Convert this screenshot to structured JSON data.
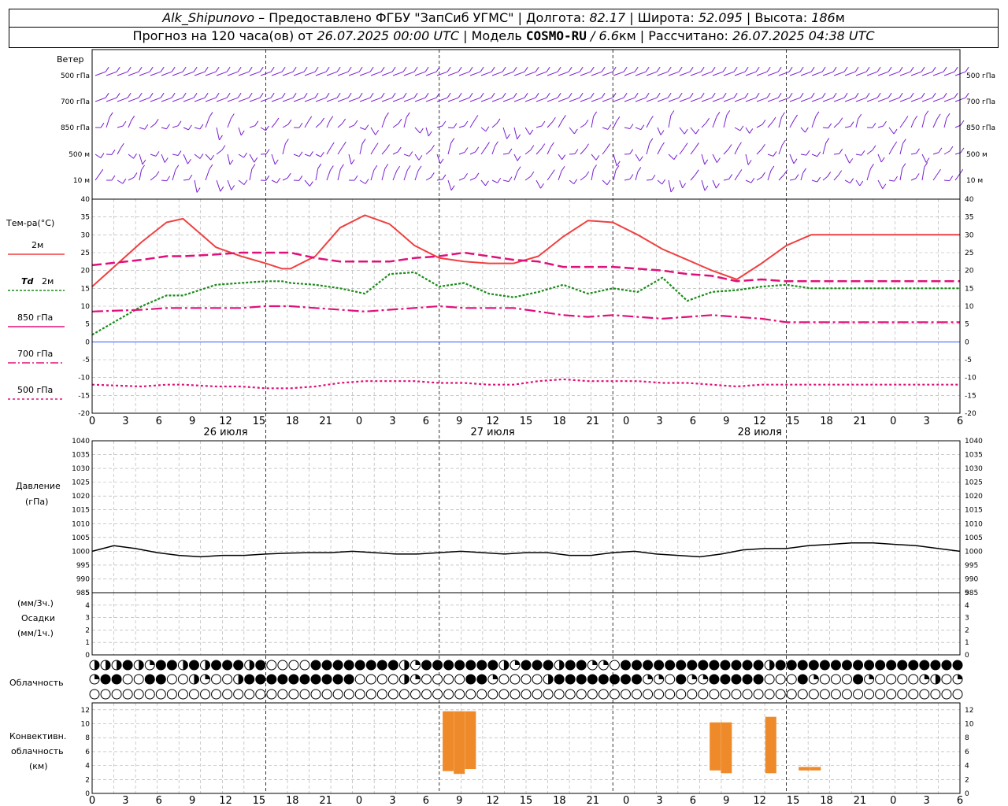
{
  "header": {
    "station": "Alk_Shipunovo",
    "provider": "– Предоставлено ФГБУ \"ЗапСиб УГМС\" | Долгота:",
    "lon": "82.17",
    "lat_label": "| Широта:",
    "lat": "52.095",
    "alt_label": "| Высота:",
    "alt": "186",
    "alt_unit": "м",
    "forecast_label": "Прогноз на 120 часа(ов) от",
    "forecast_from": "26.07.2025 00:00 UTC",
    "model_label": "| Модель",
    "model": "COSMO-RU",
    "model_res": "/ 6.6",
    "model_unit": "км | Рассчитано:",
    "calc_time": "26.07.2025 04:38 UTC"
  },
  "wind": {
    "title": "Ветер",
    "levels": [
      "500 гПа",
      "700 гПа",
      "850 гПа",
      "500 м",
      "10 м"
    ]
  },
  "temperature": {
    "title": "Тем-ра(°C)",
    "legend": {
      "t2m": "2м",
      "td": "Td",
      "td_suffix": "2м",
      "l850": "850 гПа",
      "l700": "700 гПа",
      "l500": "500 гПа"
    },
    "colors": {
      "t2m": "#f04040",
      "td": "#1a8c1a",
      "t850": "#e0107a",
      "t700": "#e0107a",
      "t500": "#e0107a"
    },
    "yticks": [
      "40",
      "35",
      "30",
      "25",
      "20",
      "15",
      "10",
      "5",
      "0",
      "-5",
      "-10",
      "-15",
      "-20"
    ]
  },
  "xaxis": {
    "hours": [
      "0",
      "3",
      "6",
      "9",
      "12",
      "15",
      "18",
      "21",
      "0",
      "3",
      "6",
      "9",
      "12",
      "15",
      "18",
      "21",
      "0",
      "3",
      "6",
      "9",
      "12",
      "15",
      "18",
      "21",
      "0",
      "3",
      "6"
    ],
    "days": [
      "26 июля",
      "27 июля",
      "28 июля"
    ]
  },
  "pressure": {
    "title1": "Давление",
    "title2": "(гПа)",
    "yticks": [
      "1040",
      "1035",
      "1030",
      "1025",
      "1020",
      "1015",
      "1010",
      "1005",
      "1000",
      "995",
      "990",
      "985"
    ]
  },
  "precip": {
    "title1": "(мм/3ч.)",
    "title2": "Осадки",
    "title3": "(мм/1ч.)",
    "yticks": [
      "5",
      "4",
      "3",
      "2",
      "1",
      "0"
    ]
  },
  "clouds": {
    "title": "Облачность"
  },
  "convective": {
    "title1": "Конвективн.",
    "title2": "облачность",
    "title3": "(км)",
    "yticks": [
      "12",
      "10",
      "8",
      "6",
      "4",
      "2",
      "0"
    ],
    "color": "#ee8a2a"
  },
  "chart_data": [
    {
      "type": "line",
      "title": "Тем-ра(°C)",
      "x_hours": [
        0,
        6,
        9,
        11,
        15,
        18,
        21,
        23,
        24,
        27,
        30,
        33,
        36,
        39,
        42,
        45,
        48,
        51,
        54,
        57,
        60,
        63,
        66,
        69,
        72,
        75,
        78,
        81,
        84,
        87,
        90,
        93,
        96,
        99,
        102,
        105
      ],
      "ylim": [
        -20,
        40
      ],
      "series": [
        {
          "name": "2м",
          "values": [
            15.5,
            28,
            33.5,
            34.5,
            26.5,
            24,
            22,
            20.5,
            20.5,
            24,
            32,
            35.5,
            33,
            27,
            23.5,
            22.5,
            22,
            22,
            24,
            29.5,
            34,
            33.5,
            30,
            26,
            23,
            20,
            17.5,
            22,
            27,
            30,
            30,
            30,
            30,
            30,
            30,
            30
          ]
        },
        {
          "name": "Td 2м",
          "values": [
            2,
            10,
            13,
            13,
            16,
            16.5,
            17,
            17,
            16.5,
            16,
            15,
            13.5,
            19,
            19.5,
            15.5,
            16.5,
            13.5,
            12.5,
            14,
            16,
            13.5,
            15,
            14,
            18,
            11.5,
            14,
            14.5,
            15.5,
            16,
            15,
            15,
            15,
            15,
            15,
            15,
            15
          ]
        },
        {
          "name": "850 гПа",
          "values": [
            8.5,
            9,
            9.5,
            9.5,
            9.5,
            9.5,
            10,
            10,
            10,
            9.5,
            9,
            8.5,
            9,
            9.5,
            10,
            9.5,
            9.5,
            9.5,
            8.5,
            7.5,
            7,
            7.5,
            7,
            6.5,
            7,
            7.5,
            7,
            6.5,
            5.5,
            5.5,
            5.5,
            5.5,
            5.5,
            5.5,
            5.5,
            5.5
          ]
        },
        {
          "name": "700 гПа",
          "values": [
            21.5,
            23,
            24,
            24,
            24.5,
            25,
            25,
            25,
            25,
            23.5,
            22.5,
            22.5,
            22.5,
            23.5,
            24,
            25,
            24,
            23,
            22.5,
            21,
            21,
            21,
            20.5,
            20,
            19,
            18.5,
            17,
            17.5,
            17,
            17,
            17,
            17,
            17,
            17,
            17,
            17
          ]
        },
        {
          "name": "500 гПа",
          "values": [
            -12,
            -12.5,
            -12,
            -12,
            -12.5,
            -12.5,
            -13,
            -13,
            -13,
            -12.5,
            -11.5,
            -11,
            -11,
            -11,
            -11.5,
            -11.5,
            -12,
            -12,
            -11,
            -10.5,
            -11,
            -11,
            -11,
            -11.5,
            -11.5,
            -12,
            -12.5,
            -12,
            -12,
            -12,
            -12,
            -12,
            -12,
            -12,
            -12,
            -12
          ]
        }
      ]
    },
    {
      "type": "line",
      "title": "Давление",
      "ylabel": "(гПа)",
      "ylim": [
        985,
        1040
      ],
      "x_hours": [
        0,
        3,
        6,
        9,
        12,
        15,
        18,
        21,
        24,
        27,
        30,
        33,
        36,
        39,
        42,
        45,
        48,
        51,
        54,
        57,
        60,
        63,
        66,
        69,
        72,
        75,
        78,
        81,
        84,
        87,
        90,
        93,
        96,
        99,
        102,
        105,
        108,
        111,
        114,
        117,
        120
      ],
      "series": [
        {
          "name": "",
          "values": [
            1000,
            1002,
            1001,
            999.5,
            998.5,
            998,
            998.5,
            998.5,
            999,
            999.3,
            999.5,
            999.5,
            1000,
            999.5,
            999,
            999,
            999.5,
            1000,
            999.5,
            999,
            999.5,
            999.5,
            998.5,
            998.5,
            999.5,
            1000,
            999,
            998.5,
            998,
            999,
            1000.5,
            1001,
            1001,
            1002,
            1002.5,
            1003,
            1003,
            1002.5,
            1002,
            1001,
            1000
          ]
        }
      ]
    },
    {
      "type": "bar",
      "title": "Конвективн. облачность",
      "ylabel": "(км)",
      "ylim": [
        0,
        13
      ],
      "bars": [
        {
          "hour": 32,
          "base": 3.2,
          "top": 11.8
        },
        {
          "hour": 33,
          "base": 2.8,
          "top": 11.8
        },
        {
          "hour": 34,
          "base": 3.5,
          "top": 11.8
        },
        {
          "hour": 56,
          "base": 3.3,
          "top": 10.2
        },
        {
          "hour": 57,
          "base": 2.9,
          "top": 10.2
        },
        {
          "hour": 61,
          "base": 2.9,
          "top": 11.0
        },
        {
          "hour": 64,
          "base": 3.3,
          "top": 3.8
        },
        {
          "hour": 65,
          "base": 3.3,
          "top": 3.8
        }
      ]
    }
  ],
  "cloud_rows": {
    "row1": "pppbpqbbpbpbbbpboooobbbbbbbbpqbbbbbbbpqbbbpbbqqobbbbbbbbbbbbbpbbbbbbbbbbbbbbbbbbbqbbbbbbbbbbbbbbbbbbbbbbbboooooooooooooooooooooooooooooooooooooooooqb",
    "row2": "qbboobboopqoopbbbbbbbbbboooopqoooobbqoooopbbbbbbbbqqobqqbbbbbooobqooobqooooqpoqooqoooooooooooooooooooooooooooooooooooooooooooooooooooooooooqb",
    "row3": "o"
  }
}
